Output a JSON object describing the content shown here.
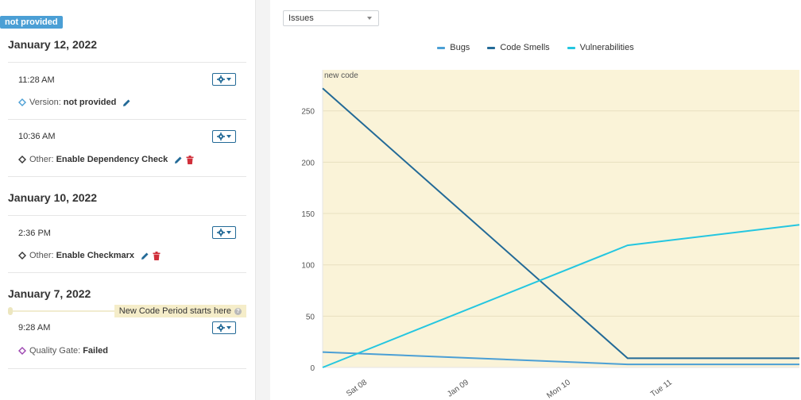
{
  "badge": "not provided",
  "days": [
    {
      "title": "January 12, 2022"
    },
    {
      "title": "January 10, 2022"
    },
    {
      "title": "January 7, 2022"
    }
  ],
  "events": [
    {
      "time": "11:28 AM",
      "kind": "Version:",
      "value": "not provided",
      "icon_color": "#4b9fd5"
    },
    {
      "time": "10:36 AM",
      "kind": "Other:",
      "value": "Enable Dependency Check",
      "icon_color": "#333333"
    },
    {
      "time": "2:36 PM",
      "kind": "Other:",
      "value": "Enable Checkmarx",
      "icon_color": "#333333"
    },
    {
      "time": "9:28 AM",
      "kind": "Quality Gate:",
      "value": "Failed",
      "icon_color": "#9c44b0"
    }
  ],
  "new_code_period_label": "New Code Period starts here",
  "graph_select": {
    "value": "Issues"
  },
  "legend": [
    {
      "name": "Bugs",
      "color": "#4b9fd5"
    },
    {
      "name": "Code Smells",
      "color": "#236a97"
    },
    {
      "name": "Vulnerabilities",
      "color": "#24c6e0"
    }
  ],
  "chart_data": {
    "type": "line",
    "new_code_label": "new code",
    "y_ticks": [
      0,
      50,
      100,
      150,
      200,
      250
    ],
    "ylim": [
      0,
      290
    ],
    "x_ticks": [
      "Sat 08",
      "Jan 09",
      "Mon 10",
      "Tue 11"
    ],
    "x_tick_days": [
      1,
      2,
      3,
      4
    ],
    "x_range_days": [
      0.56,
      5.25
    ],
    "series": [
      {
        "name": "Bugs",
        "color": "#4b9fd5",
        "x_days": [
          0.56,
          3.56,
          5.25
        ],
        "values": [
          15,
          3,
          3
        ]
      },
      {
        "name": "Code Smells",
        "color": "#236a97",
        "x_days": [
          0.56,
          3.56,
          5.25
        ],
        "values": [
          272,
          9,
          9
        ]
      },
      {
        "name": "Vulnerabilities",
        "color": "#24c6e0",
        "x_days": [
          0.56,
          3.56,
          5.25
        ],
        "values": [
          0,
          119,
          139
        ]
      }
    ],
    "grid": true,
    "new_code_background": "#faf3d8"
  }
}
